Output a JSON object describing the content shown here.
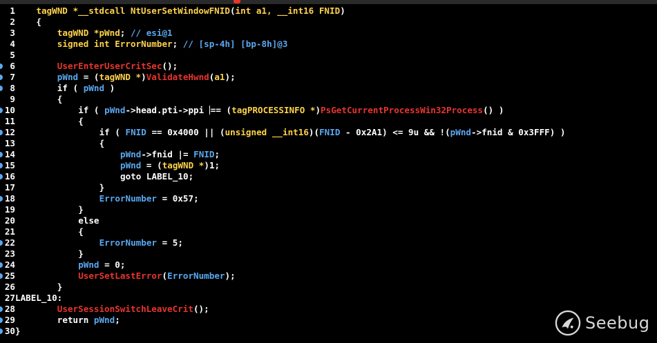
{
  "colors": {
    "background": "#000000",
    "plain": "#ffffff",
    "type": "#ffd24a",
    "variable": "#5aa8f0",
    "comment": "#5aa8f0",
    "call": "#e8352e",
    "gutter_dot": "#5aa8f0"
  },
  "code_lines": [
    {
      "no": "1",
      "dot": false,
      "indent": 0,
      "tokens": [
        {
          "t": "tagWND *__stdcall NtUserSetWindowFNID",
          "c": "type"
        },
        {
          "t": "(",
          "c": "plain"
        },
        {
          "t": "int a1, __int16 FNID",
          "c": "type"
        },
        {
          "t": ")",
          "c": "plain"
        }
      ]
    },
    {
      "no": "2",
      "dot": false,
      "indent": 0,
      "tokens": [
        {
          "t": "{",
          "c": "plain"
        }
      ]
    },
    {
      "no": "3",
      "dot": false,
      "indent": 4,
      "tokens": [
        {
          "t": "tagWND *pWnd",
          "c": "type"
        },
        {
          "t": "; ",
          "c": "plain"
        },
        {
          "t": "// esi@1",
          "c": "comment"
        }
      ]
    },
    {
      "no": "4",
      "dot": false,
      "indent": 4,
      "tokens": [
        {
          "t": "signed int ErrorNumber",
          "c": "type"
        },
        {
          "t": "; ",
          "c": "plain"
        },
        {
          "t": "// [sp-4h] [bp-8h]@3",
          "c": "comment"
        }
      ]
    },
    {
      "no": "5",
      "dot": false,
      "indent": 0,
      "tokens": []
    },
    {
      "no": "6",
      "dot": true,
      "indent": 4,
      "tokens": [
        {
          "t": "UserEnterUserCritSec",
          "c": "call"
        },
        {
          "t": "();",
          "c": "plain"
        }
      ]
    },
    {
      "no": "7",
      "dot": true,
      "indent": 4,
      "tokens": [
        {
          "t": "pWnd",
          "c": "variable"
        },
        {
          "t": " = (",
          "c": "plain"
        },
        {
          "t": "tagWND *",
          "c": "type"
        },
        {
          "t": ")",
          "c": "plain"
        },
        {
          "t": "ValidateHwnd",
          "c": "call"
        },
        {
          "t": "(",
          "c": "plain"
        },
        {
          "t": "a1",
          "c": "type"
        },
        {
          "t": ");",
          "c": "plain"
        }
      ]
    },
    {
      "no": "8",
      "dot": true,
      "indent": 4,
      "tokens": [
        {
          "t": "if ( ",
          "c": "plain"
        },
        {
          "t": "pWnd",
          "c": "variable"
        },
        {
          "t": " )",
          "c": "plain"
        }
      ]
    },
    {
      "no": "9",
      "dot": false,
      "indent": 4,
      "tokens": [
        {
          "t": "{",
          "c": "plain"
        }
      ]
    },
    {
      "no": "10",
      "dot": true,
      "indent": 8,
      "cursor_before": "== (",
      "tokens": [
        {
          "t": "if ( ",
          "c": "plain"
        },
        {
          "t": "pWnd",
          "c": "variable"
        },
        {
          "t": "->head.pti->ppi ",
          "c": "plain"
        },
        {
          "t": "|",
          "c": "cursor"
        },
        {
          "t": "== (",
          "c": "plain"
        },
        {
          "t": "tagPROCESSINFO *",
          "c": "type"
        },
        {
          "t": ")",
          "c": "plain"
        },
        {
          "t": "PsGetCurrentProcessWin32Process",
          "c": "call"
        },
        {
          "t": "() )",
          "c": "plain"
        }
      ]
    },
    {
      "no": "11",
      "dot": false,
      "indent": 8,
      "tokens": [
        {
          "t": "{",
          "c": "plain"
        }
      ]
    },
    {
      "no": "12",
      "dot": true,
      "indent": 12,
      "tokens": [
        {
          "t": "if ( ",
          "c": "plain"
        },
        {
          "t": "FNID",
          "c": "variable"
        },
        {
          "t": " == 0x4000 || (",
          "c": "plain"
        },
        {
          "t": "unsigned __int16",
          "c": "type"
        },
        {
          "t": ")(",
          "c": "plain"
        },
        {
          "t": "FNID",
          "c": "variable"
        },
        {
          "t": " - 0x2A1) <= 9u && !(",
          "c": "plain"
        },
        {
          "t": "pWnd",
          "c": "variable"
        },
        {
          "t": "->fnid & 0x3FFF) )",
          "c": "plain"
        }
      ]
    },
    {
      "no": "13",
      "dot": false,
      "indent": 12,
      "tokens": [
        {
          "t": "{",
          "c": "plain"
        }
      ]
    },
    {
      "no": "14",
      "dot": true,
      "indent": 16,
      "tokens": [
        {
          "t": "pWnd",
          "c": "variable"
        },
        {
          "t": "->fnid |= ",
          "c": "plain"
        },
        {
          "t": "FNID",
          "c": "variable"
        },
        {
          "t": ";",
          "c": "plain"
        }
      ]
    },
    {
      "no": "15",
      "dot": true,
      "indent": 16,
      "tokens": [
        {
          "t": "pWnd",
          "c": "variable"
        },
        {
          "t": " = (",
          "c": "plain"
        },
        {
          "t": "tagWND *",
          "c": "type"
        },
        {
          "t": ")1;",
          "c": "plain"
        }
      ]
    },
    {
      "no": "16",
      "dot": true,
      "indent": 16,
      "tokens": [
        {
          "t": "goto LABEL_10;",
          "c": "plain"
        }
      ]
    },
    {
      "no": "17",
      "dot": false,
      "indent": 12,
      "tokens": [
        {
          "t": "}",
          "c": "plain"
        }
      ]
    },
    {
      "no": "18",
      "dot": true,
      "indent": 12,
      "tokens": [
        {
          "t": "ErrorNumber",
          "c": "variable"
        },
        {
          "t": " = 0x57;",
          "c": "plain"
        }
      ]
    },
    {
      "no": "19",
      "dot": false,
      "indent": 8,
      "tokens": [
        {
          "t": "}",
          "c": "plain"
        }
      ]
    },
    {
      "no": "20",
      "dot": false,
      "indent": 8,
      "tokens": [
        {
          "t": "else",
          "c": "plain"
        }
      ]
    },
    {
      "no": "21",
      "dot": false,
      "indent": 8,
      "tokens": [
        {
          "t": "{",
          "c": "plain"
        }
      ]
    },
    {
      "no": "22",
      "dot": true,
      "indent": 12,
      "tokens": [
        {
          "t": "ErrorNumber",
          "c": "variable"
        },
        {
          "t": " = 5;",
          "c": "plain"
        }
      ]
    },
    {
      "no": "23",
      "dot": false,
      "indent": 8,
      "tokens": [
        {
          "t": "}",
          "c": "plain"
        }
      ]
    },
    {
      "no": "24",
      "dot": true,
      "indent": 8,
      "tokens": [
        {
          "t": "pWnd",
          "c": "variable"
        },
        {
          "t": " = 0;",
          "c": "plain"
        }
      ]
    },
    {
      "no": "25",
      "dot": true,
      "indent": 8,
      "tokens": [
        {
          "t": "UserSetLastError",
          "c": "call"
        },
        {
          "t": "(",
          "c": "plain"
        },
        {
          "t": "ErrorNumber",
          "c": "variable"
        },
        {
          "t": ");",
          "c": "plain"
        }
      ]
    },
    {
      "no": "26",
      "dot": false,
      "indent": 4,
      "tokens": [
        {
          "t": "}",
          "c": "plain"
        }
      ]
    },
    {
      "no": "27",
      "dot": false,
      "indent": -4,
      "tokens": [
        {
          "t": "LABEL_10:",
          "c": "plain"
        }
      ]
    },
    {
      "no": "28",
      "dot": true,
      "indent": 4,
      "tokens": [
        {
          "t": "UserSessionSwitchLeaveCrit",
          "c": "call"
        },
        {
          "t": "();",
          "c": "plain"
        }
      ]
    },
    {
      "no": "29",
      "dot": true,
      "indent": 4,
      "tokens": [
        {
          "t": "return ",
          "c": "plain"
        },
        {
          "t": "pWnd",
          "c": "variable"
        },
        {
          "t": ";",
          "c": "plain"
        }
      ]
    },
    {
      "no": "30",
      "dot": true,
      "indent": -4,
      "tokens": [
        {
          "t": "}",
          "c": "plain"
        }
      ]
    }
  ],
  "watermark": {
    "text": "Seebug",
    "icon": "seebug-bug-icon"
  }
}
